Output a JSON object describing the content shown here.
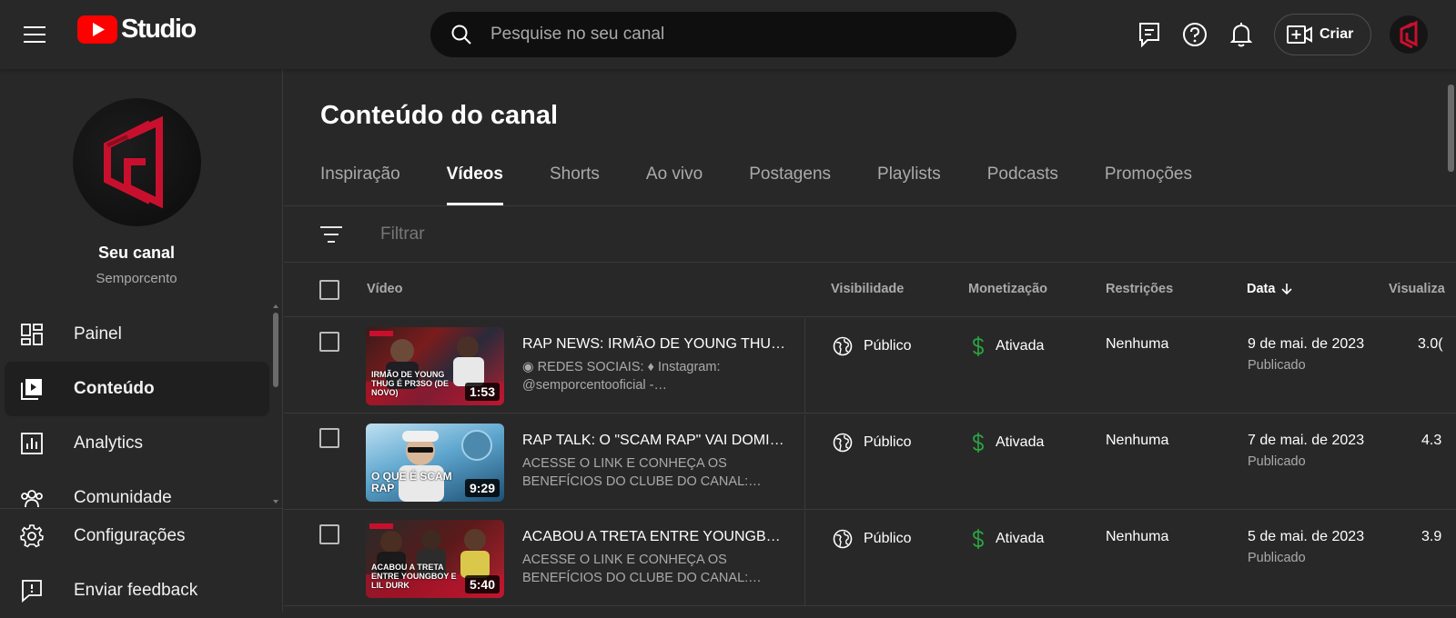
{
  "topbar": {
    "logo_text": "Studio",
    "search_placeholder": "Pesquise no seu canal",
    "create_label": "Criar"
  },
  "sidebar": {
    "channel_name": "Seu canal",
    "channel_handle": "Semporcento",
    "items": [
      {
        "label": "Painel",
        "icon": "dashboard-icon",
        "active": false
      },
      {
        "label": "Conteúdo",
        "icon": "content-icon",
        "active": true
      },
      {
        "label": "Analytics",
        "icon": "analytics-icon",
        "active": false
      },
      {
        "label": "Comunidade",
        "icon": "community-icon",
        "active": false
      }
    ],
    "bottom_items": [
      {
        "label": "Configurações",
        "icon": "gear-icon"
      },
      {
        "label": "Enviar feedback",
        "icon": "feedback-icon"
      }
    ]
  },
  "main": {
    "title": "Conteúdo do canal",
    "tabs": [
      "Inspiração",
      "Vídeos",
      "Shorts",
      "Ao vivo",
      "Postagens",
      "Playlists",
      "Podcasts",
      "Promoções"
    ],
    "active_tab": "Vídeos",
    "filter_placeholder": "Filtrar",
    "columns": {
      "video": "Vídeo",
      "visibility": "Visibilidade",
      "monetization": "Monetização",
      "restrictions": "Restrições",
      "date": "Data",
      "views": "Visualiza"
    },
    "rows": [
      {
        "title": "RAP NEWS: IRMÃO DE YOUNG THUG …",
        "desc1": "◉ REDES SOCIAIS: ♦ Instagram:",
        "desc2": "@semporcentooficial -…",
        "duration": "1:53",
        "visibility": "Público",
        "monetization": "Ativada",
        "restrictions": "Nenhuma",
        "date": "9 de mai. de 2023",
        "date_status": "Publicado",
        "views": "3.0("
      },
      {
        "title": "RAP TALK: O \"SCAM RAP\" VAI DOMIN…",
        "desc1": "ACESSE O LINK E CONHEÇA OS",
        "desc2": "BENEFÍCIOS DO CLUBE DO CANAL:…",
        "duration": "9:29",
        "visibility": "Público",
        "monetization": "Ativada",
        "restrictions": "Nenhuma",
        "date": "7 de mai. de 2023",
        "date_status": "Publicado",
        "views": "4.3"
      },
      {
        "title": "ACABOU A TRETA ENTRE YOUNGBOY…",
        "desc1": "ACESSE O LINK E CONHEÇA OS",
        "desc2": "BENEFÍCIOS DO CLUBE DO CANAL:…",
        "duration": "5:40",
        "visibility": "Público",
        "monetization": "Ativada",
        "restrictions": "Nenhuma",
        "date": "5 de mai. de 2023",
        "date_status": "Publicado",
        "views": "3.9"
      }
    ],
    "thumb_captions": [
      "IRMÃO DE YOUNG THUG É PR3SO (DE NOVO)",
      "O QUE É SCAM RAP",
      "ACABOU A TRETA ENTRE YOUNGBOY E LIL DURK"
    ]
  },
  "colors": {
    "background": "#282828",
    "accent_red": "#ff0000",
    "money_green": "#2ba640",
    "muted_text": "#aaaaaa"
  }
}
